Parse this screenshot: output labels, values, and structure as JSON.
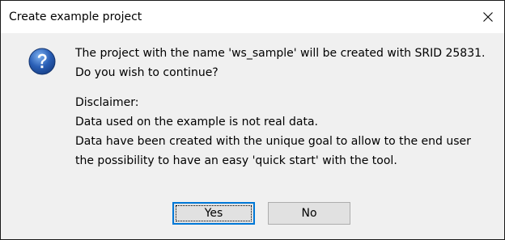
{
  "window": {
    "title": "Create example project",
    "close_icon": "close-icon"
  },
  "message": {
    "icon": "question-icon",
    "icon_color": "#2a5fb6",
    "line1": "The project with the name 'ws_sample' will be created with SRID 25831.",
    "line2": "Do you wish to continue?",
    "disclaimer_heading": "Disclaimer:",
    "disclaimer_line1": "Data used on the example is not real data.",
    "disclaimer_line2": "Data have been created with the unique goal to allow to the end user",
    "disclaimer_line3": "the possibility to have an easy 'quick start' with the tool."
  },
  "buttons": {
    "yes_label": "Yes",
    "no_label": "No",
    "default_button": "Yes",
    "focus_color": "#0078d7"
  }
}
